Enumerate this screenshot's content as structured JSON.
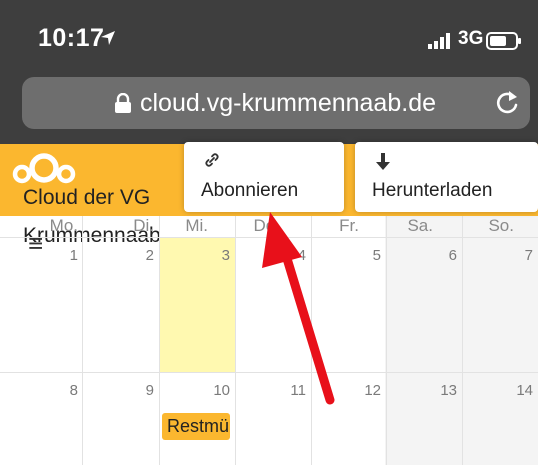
{
  "status_bar": {
    "time": "10:17",
    "network": "3G"
  },
  "browser": {
    "url": "cloud.vg-krummennaab.de"
  },
  "header": {
    "app_name": "Cloud der VG Krummennaab"
  },
  "menus": {
    "subscribe_label": "Abonnieren",
    "download_label": "Herunterladen"
  },
  "calendar": {
    "weekdays": [
      "Mo.",
      "Di.",
      "Mi.",
      "Do.",
      "Fr.",
      "Sa.",
      "So."
    ],
    "weeks": [
      [
        "1",
        "2",
        "3",
        "4",
        "5",
        "6",
        "7"
      ],
      [
        "8",
        "9",
        "10",
        "11",
        "12",
        "13",
        "14"
      ]
    ],
    "today_day": "3",
    "event": {
      "title": "Restmüll",
      "color": "#fbb72f"
    }
  },
  "colors": {
    "header": "#fbb72f",
    "today": "#fff9b0",
    "arrow": "#e8101a"
  }
}
